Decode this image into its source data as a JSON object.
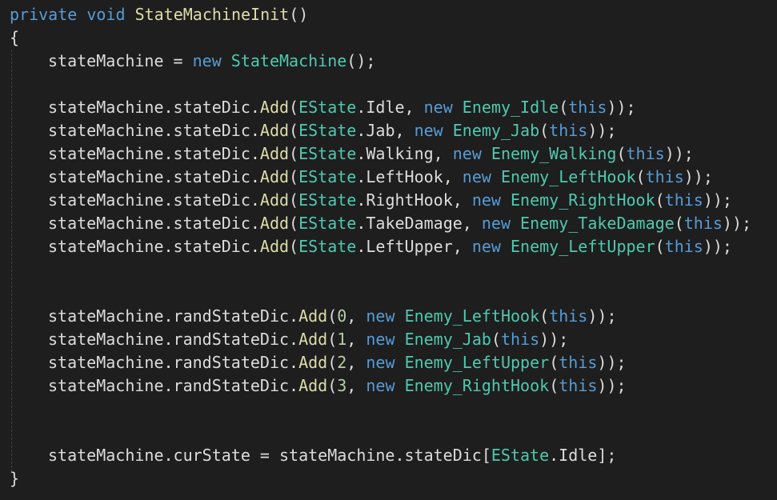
{
  "code": {
    "l1": {
      "kw1": "private",
      "kw2": "void",
      "fn": "StateMachineInit",
      "parens": "()"
    },
    "l2": {
      "brace": "{"
    },
    "l3": {
      "a": "stateMachine",
      "eq": " = ",
      "kw": "new",
      "ty": "StateMachine",
      "tail": "();"
    },
    "l5": {
      "a": "stateMachine.stateDic.",
      "fn": "Add",
      "o": "(",
      "en": "EState",
      "mem": ".Idle, ",
      "kw": "new",
      "ty": "Enemy_Idle",
      "o2": "(",
      "th": "this",
      "c": "));"
    },
    "l6": {
      "a": "stateMachine.stateDic.",
      "fn": "Add",
      "o": "(",
      "en": "EState",
      "mem": ".Jab, ",
      "kw": "new",
      "ty": "Enemy_Jab",
      "o2": "(",
      "th": "this",
      "c": "));"
    },
    "l7": {
      "a": "stateMachine.stateDic.",
      "fn": "Add",
      "o": "(",
      "en": "EState",
      "mem": ".Walking, ",
      "kw": "new",
      "ty": "Enemy_Walking",
      "o2": "(",
      "th": "this",
      "c": "));"
    },
    "l8": {
      "a": "stateMachine.stateDic.",
      "fn": "Add",
      "o": "(",
      "en": "EState",
      "mem": ".LeftHook, ",
      "kw": "new",
      "ty": "Enemy_LeftHook",
      "o2": "(",
      "th": "this",
      "c": "));"
    },
    "l9": {
      "a": "stateMachine.stateDic.",
      "fn": "Add",
      "o": "(",
      "en": "EState",
      "mem": ".RightHook, ",
      "kw": "new",
      "ty": "Enemy_RightHook",
      "o2": "(",
      "th": "this",
      "c": "));"
    },
    "l10": {
      "a": "stateMachine.stateDic.",
      "fn": "Add",
      "o": "(",
      "en": "EState",
      "mem": ".TakeDamage, ",
      "kw": "new",
      "ty": "Enemy_TakeDamage",
      "o2": "(",
      "th": "this",
      "c": "));"
    },
    "l11": {
      "a": "stateMachine.stateDic.",
      "fn": "Add",
      "o": "(",
      "en": "EState",
      "mem": ".LeftUpper, ",
      "kw": "new",
      "ty": "Enemy_LeftUpper",
      "o2": "(",
      "th": "this",
      "c": "));"
    },
    "l14": {
      "a": "stateMachine.randStateDic.",
      "fn": "Add",
      "o": "(",
      "num": "0",
      "sep": ", ",
      "kw": "new",
      "ty": "Enemy_LeftHook",
      "o2": "(",
      "th": "this",
      "c": "));"
    },
    "l15": {
      "a": "stateMachine.randStateDic.",
      "fn": "Add",
      "o": "(",
      "num": "1",
      "sep": ", ",
      "kw": "new",
      "ty": "Enemy_Jab",
      "o2": "(",
      "th": "this",
      "c": "));"
    },
    "l16": {
      "a": "stateMachine.randStateDic.",
      "fn": "Add",
      "o": "(",
      "num": "2",
      "sep": ", ",
      "kw": "new",
      "ty": "Enemy_LeftUpper",
      "o2": "(",
      "th": "this",
      "c": "));"
    },
    "l17": {
      "a": "stateMachine.randStateDic.",
      "fn": "Add",
      "o": "(",
      "num": "3",
      "sep": ", ",
      "kw": "new",
      "ty": "Enemy_RightHook",
      "o2": "(",
      "th": "this",
      "c": "));"
    },
    "l20": {
      "a": "stateMachine.curState = stateMachine.stateDic[",
      "en": "EState",
      "mem": ".Idle];"
    },
    "l21": {
      "brace": "}"
    }
  },
  "colors": {
    "background": "#1e1e1e",
    "keyword": "#569cd6",
    "function": "#dcdcaa",
    "type": "#4ec9b0",
    "number": "#b5cea8",
    "text": "#dcdcdc"
  }
}
